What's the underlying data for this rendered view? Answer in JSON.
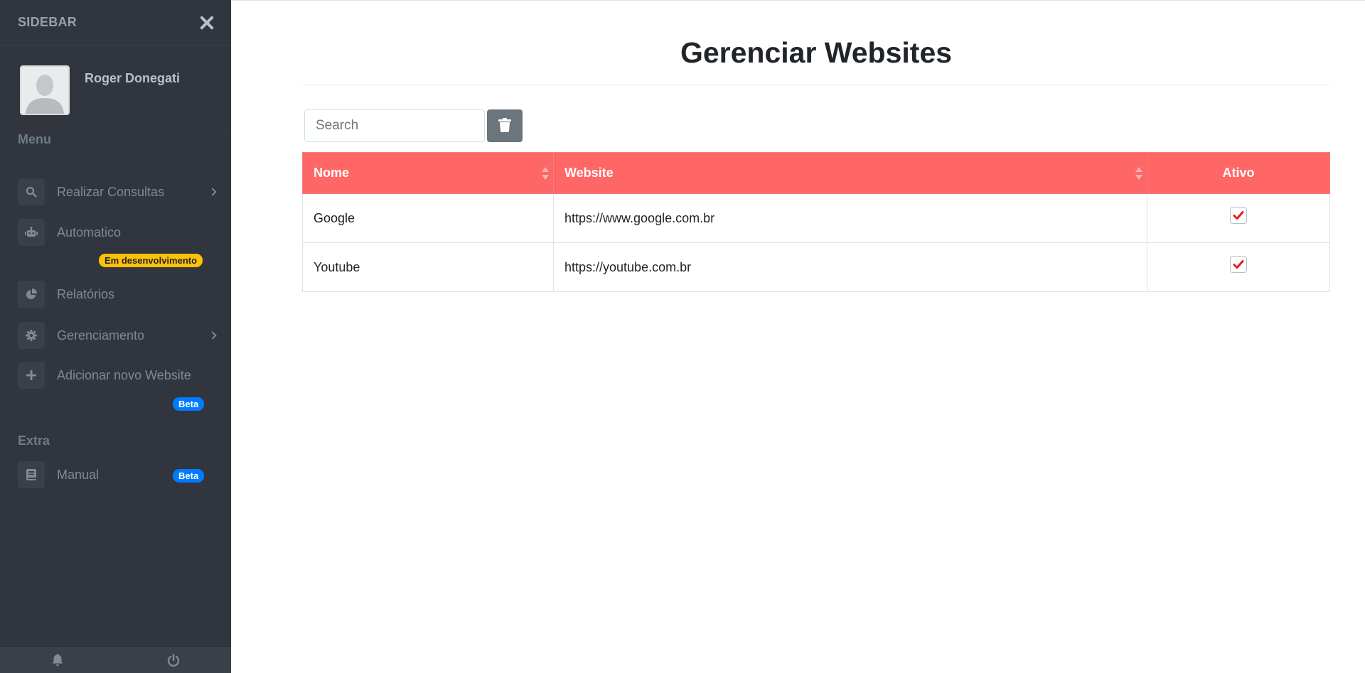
{
  "sidebar": {
    "brand": "SIDEBAR",
    "user_name": "Roger Donegati",
    "sections": {
      "menu": "Menu",
      "extra": "Extra"
    },
    "items": [
      {
        "label": "Realizar Consultas",
        "icon": "search-icon"
      },
      {
        "label": "Automatico",
        "icon": "robot-icon",
        "badge": "Em desenvolvimento"
      },
      {
        "label": "Relatórios",
        "icon": "pie-chart-icon"
      },
      {
        "label": "Gerenciamento",
        "icon": "gear-icon"
      },
      {
        "label": "Adicionar novo Website",
        "icon": "plus-icon",
        "badge": "Beta"
      },
      {
        "label": "Manual",
        "icon": "book-icon",
        "badge": "Beta"
      }
    ]
  },
  "main": {
    "title": "Gerenciar Websites",
    "search_placeholder": "Search",
    "table": {
      "headers": [
        "Nome",
        "Website",
        "Ativo"
      ],
      "rows": [
        {
          "nome": "Google",
          "website": "https://www.google.com.br",
          "ativo": true
        },
        {
          "nome": "Youtube",
          "website": "https://youtube.com.br",
          "ativo": true
        }
      ]
    }
  },
  "colors": {
    "sidebar_bg": "#31353d",
    "table_header": "#ff6666",
    "check": "#e8191d",
    "badge_warning": "#ffc107",
    "badge_primary": "#007bff"
  }
}
